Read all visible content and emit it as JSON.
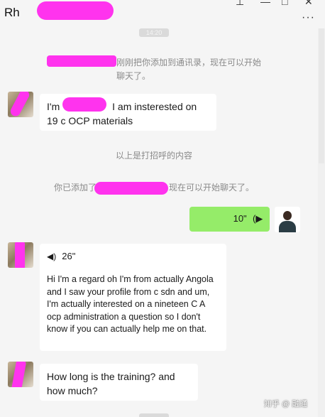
{
  "window": {
    "title": "Rh",
    "controls": {
      "pin": "⊥",
      "minimize": "—",
      "maximize": "□",
      "close": "✕"
    },
    "more": "···"
  },
  "time_top": "14:20",
  "messages": {
    "sys_added_by": "刚刚把你添加到通讯录，现在可以开始聊天了。",
    "greeting_prefix": "I'm",
    "greeting_suffix": "I am insterested on 19 c OCP materials",
    "sys_above_greeting": "以上是打招呼的内容",
    "sys_you_added_prefix": "你已添加了",
    "sys_you_added_suffix": "现在可以开始聊天了。",
    "outgoing_voice_duration": "10\"",
    "incoming_voice_duration": "26\"",
    "incoming_voice_transcript": "Hi I'm a regard oh I'm from actually Angola and I saw your profile from c sdn and um, I'm actually interested on a nineteen C A ocp administration a question so I don't know if you can actually help me on that.",
    "last_question": "How long is the training? and how much?"
  },
  "watermark": "知乎 @ 融通"
}
